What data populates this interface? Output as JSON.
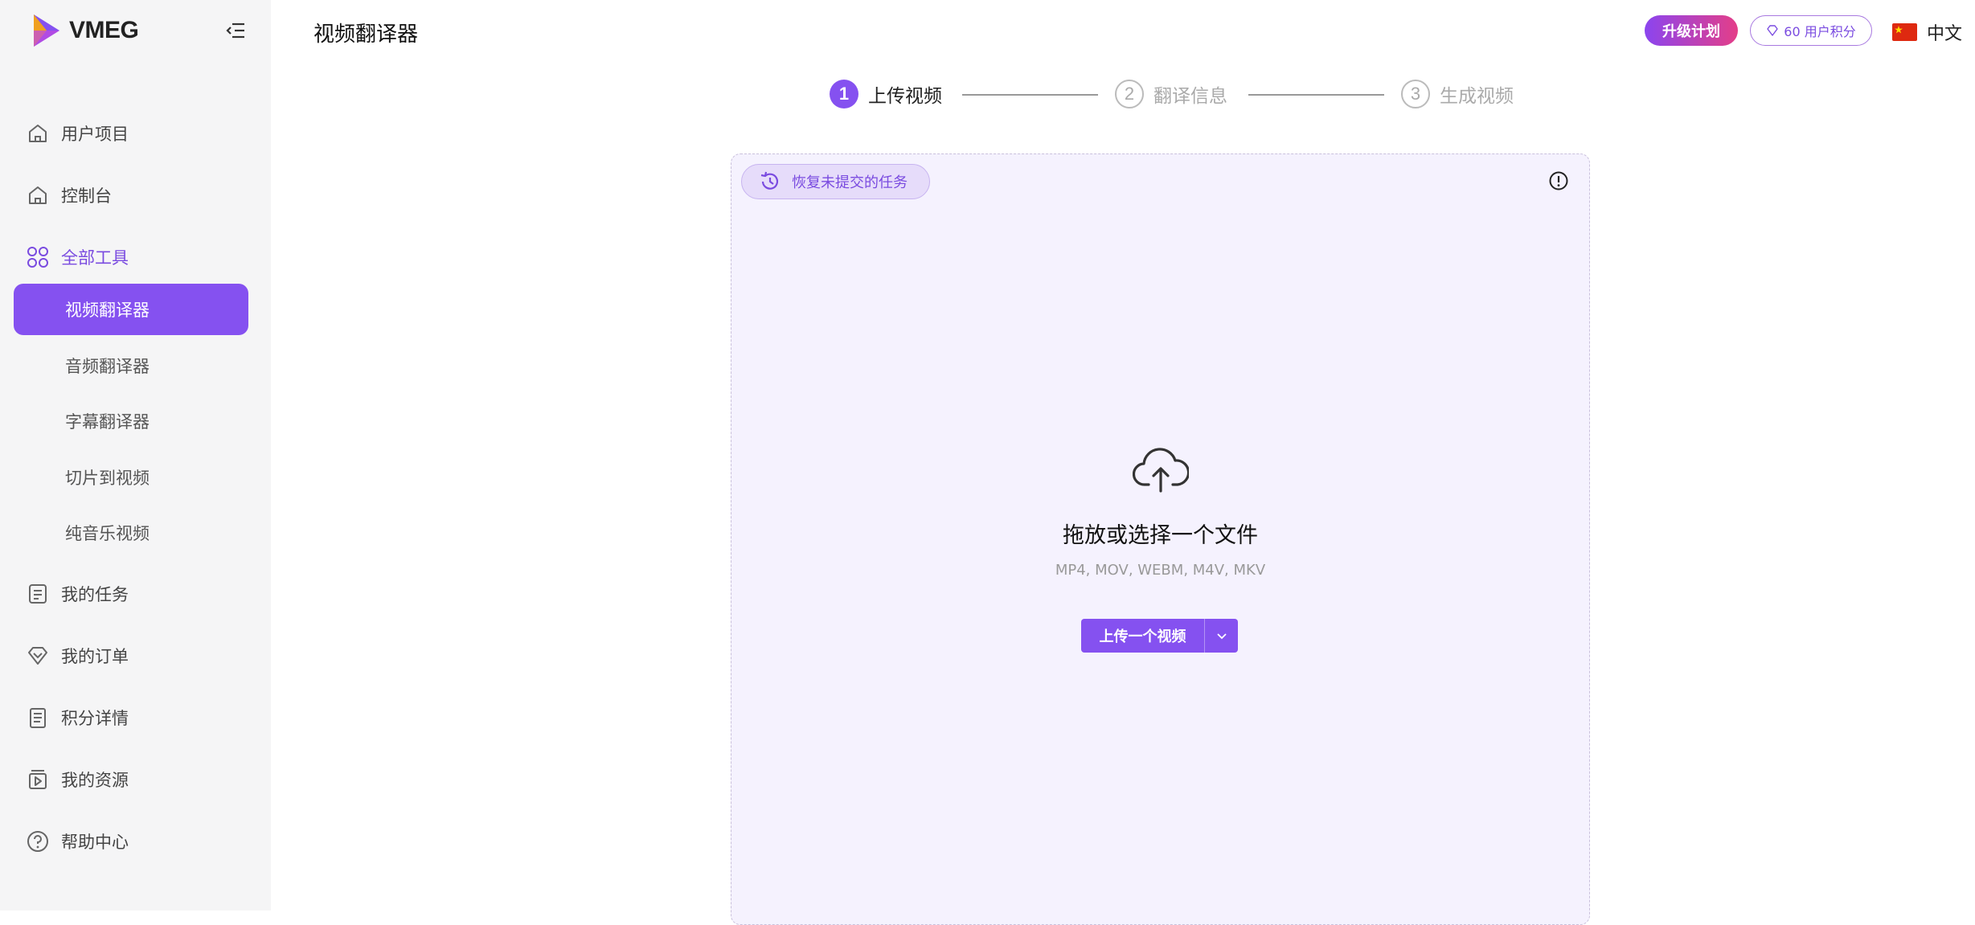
{
  "app": {
    "name": "VMEG",
    "page_title": "视频翻译器"
  },
  "sidebar": {
    "items": [
      {
        "label": "用户项目",
        "icon": "home-icon"
      },
      {
        "label": "控制台",
        "icon": "home-icon"
      },
      {
        "label": "全部工具",
        "icon": "grid-icon"
      },
      {
        "label": "我的任务",
        "icon": "checklist-icon"
      },
      {
        "label": "我的订单",
        "icon": "diamond-icon"
      },
      {
        "label": "积分详情",
        "icon": "clipboard-icon"
      },
      {
        "label": "我的资源",
        "icon": "media-icon"
      },
      {
        "label": "帮助中心",
        "icon": "help-icon"
      }
    ],
    "tools": [
      {
        "label": "视频翻译器",
        "active": true
      },
      {
        "label": "音频翻译器",
        "active": false
      },
      {
        "label": "字幕翻译器",
        "active": false
      },
      {
        "label": "切片到视频",
        "active": false
      },
      {
        "label": "纯音乐视频",
        "active": false
      }
    ]
  },
  "header": {
    "upgrade_label": "升级计划",
    "points_label": "60 用户积分",
    "language": "中文"
  },
  "steps": [
    {
      "num": "1",
      "label": "上传视频",
      "active": true
    },
    {
      "num": "2",
      "label": "翻译信息",
      "active": false
    },
    {
      "num": "3",
      "label": "生成视频",
      "active": false
    }
  ],
  "dropzone": {
    "restore_label": "恢复未提交的任务",
    "title": "拖放或选择一个文件",
    "formats": "MP4, MOV, WEBM, M4V, MKV",
    "upload_label": "上传一个视频"
  },
  "colors": {
    "accent": "#8551f0",
    "accent_text": "#7a4be0",
    "dropzone_bg": "#f5f2fe"
  }
}
